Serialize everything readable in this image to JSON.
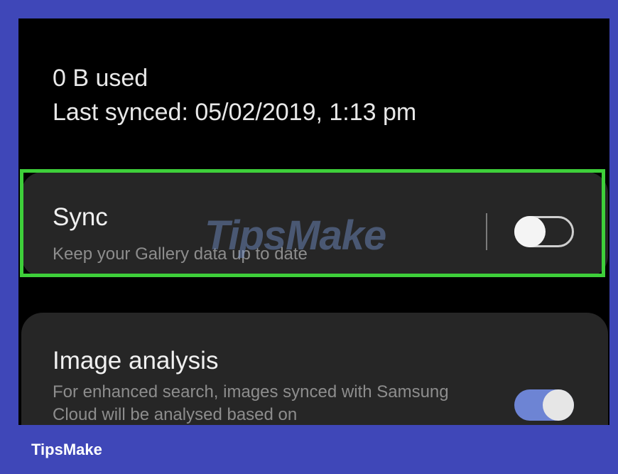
{
  "storage": {
    "used": "0 B  used",
    "last_synced": "Last synced: 05/02/2019, 1:13 pm"
  },
  "sync": {
    "title": "Sync",
    "subtitle": "Keep your Gallery data up to date",
    "toggle_state": "off"
  },
  "image_analysis": {
    "title": "Image analysis",
    "subtitle": "For enhanced search, images synced with Samsung Cloud will be analysed based on",
    "toggle_state": "on"
  },
  "watermark": "TipsMake",
  "footer": {
    "brand": "TipsMake"
  },
  "colors": {
    "frame": "#3f47b8",
    "highlight": "#3ecf3a",
    "toggle_on": "#6d84d4"
  }
}
